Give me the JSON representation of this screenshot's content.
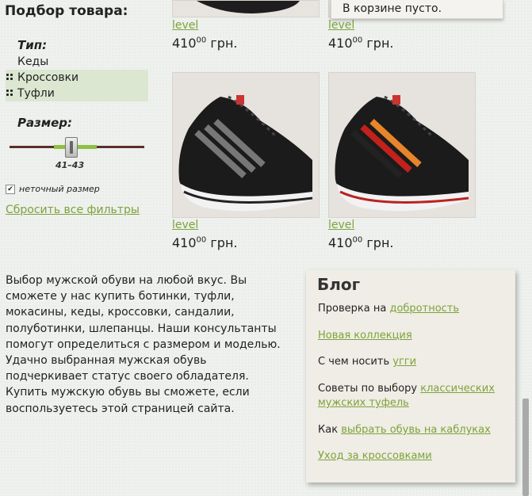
{
  "filter": {
    "title": "Подбор товара:",
    "type_label": "Тип:",
    "types": [
      {
        "label": "Кеды",
        "selected": false
      },
      {
        "label": "Кроссовки",
        "selected": true
      },
      {
        "label": "Туфли",
        "selected": true
      }
    ],
    "size_label": "Размер:",
    "size_value": "41–43",
    "inexact_label": "неточный размер",
    "inexact_checked": true,
    "reset_label": "Сбросить все фильтры"
  },
  "cart": {
    "text": "В корзине пусто."
  },
  "products": [
    {
      "link": "level",
      "price_main": "410",
      "price_cents": "00",
      "currency": "грн.",
      "stripe": "#777777"
    },
    {
      "link": "level",
      "price_main": "410",
      "price_cents": "00",
      "currency": "грн.",
      "stripe": "#d35a2a"
    },
    {
      "link": "level",
      "price_main": "410",
      "price_cents": "00",
      "currency": "грн.",
      "stripe": "#777777"
    },
    {
      "link": "level",
      "price_main": "410",
      "price_cents": "00",
      "currency": "грн.",
      "stripe": "#d35a2a"
    }
  ],
  "description": "Выбор мужской обуви на любой вкус. Вы сможете у нас купить ботинки, туфли, мокасины, кеды, кроссовки, сандалии, полуботинки, шлепанцы. Наши консультанты помогут определиться с размером и моделью. Удачно выбранная мужская обувь подчеркивает статус своего обладателя. Купить мужскую обувь вы сможете, если воспользуетесь этой страницей сайта.",
  "blog": {
    "title": "Блог",
    "items": [
      {
        "prefix": "Проверка на ",
        "link": "добротность"
      },
      {
        "prefix": "",
        "link": "Новая коллекция"
      },
      {
        "prefix": "С чем носить ",
        "link": "угги"
      },
      {
        "prefix": "Советы по выбору ",
        "link": "классических мужских туфель"
      },
      {
        "prefix": "Как ",
        "link": "выбрать обувь на каблуках"
      },
      {
        "prefix": "",
        "link": "Уход за кроссовками"
      }
    ]
  },
  "colors": {
    "accent_link": "#7ea23a",
    "selected_bg": "#dbe7d1",
    "slider_range": "#8cc142"
  }
}
